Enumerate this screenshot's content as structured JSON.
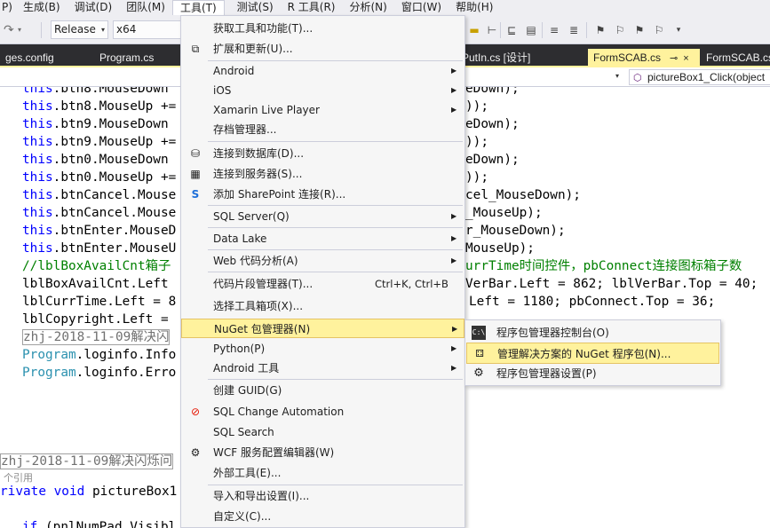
{
  "menubar": {
    "items": [
      {
        "label": "P)"
      },
      {
        "label": "生成(B)"
      },
      {
        "label": "调试(D)"
      },
      {
        "label": "团队(M)"
      },
      {
        "label": "工具(T)"
      },
      {
        "label": "测试(S)"
      },
      {
        "label": "R 工具(R)"
      },
      {
        "label": "分析(N)"
      },
      {
        "label": "窗口(W)"
      },
      {
        "label": "帮助(H)"
      }
    ]
  },
  "toolbar": {
    "configuration": "Release",
    "platform": "x64"
  },
  "tabs": [
    {
      "label": "ges.config"
    },
    {
      "label": "Program.cs"
    },
    {
      "label": "mPutIn.cs [设计]"
    },
    {
      "label": "FormSCAB.cs",
      "pin": "⊸",
      "close": "×"
    },
    {
      "label": "FormSCAB.cs"
    }
  ],
  "navbar": {
    "member": "pictureBox1_Click(object"
  },
  "code": {
    "lines": [
      {
        "kw": "this",
        "text": ".btn8.MouseDown",
        "right": "eDown);"
      },
      {
        "kw": "this",
        "text": ".btn8.MouseUp +=",
        "right": "));"
      },
      {
        "kw": "this",
        "text": ".btn9.MouseDown",
        "right": "eDown);"
      },
      {
        "kw": "this",
        "text": ".btn9.MouseUp +=",
        "right": "));"
      },
      {
        "kw": "this",
        "text": ".btn0.MouseDown",
        "right": "eDown);"
      },
      {
        "kw": "this",
        "text": ".btn0.MouseUp +=",
        "right": "));"
      },
      {
        "kw": "this",
        "text": ".btnCancel.Mouse",
        "right": "cel_MouseDown);"
      },
      {
        "kw": "this",
        "text": ".btnCancel.Mouse",
        "right": "_MouseUp);"
      },
      {
        "kw": "this",
        "text": ".btnEnter.MouseD",
        "right": "r_MouseDown);"
      },
      {
        "kw": "this",
        "text": ".btnEnter.MouseU",
        "right": "MouseUp);"
      },
      {
        "comment": "//lblBoxAvailCnt箱子",
        "right_comment": "urrTime时间控件，pbConnect连接图标箱子数"
      },
      {
        "text": "lblBoxAvailCnt.Left",
        "right": "VerBar.Left = 862; lblVerBar.Top = 40;"
      },
      {
        "text": "lblCurrTime.Left = 8",
        "right": "Left = 1180; pbConnect.Top = 36;"
      },
      {
        "text": "lblCopyright.Left =",
        "right": ""
      },
      {
        "boxed": "zhj-2018-11-09解决闪"
      },
      {
        "type": "Program",
        "text": ".loginfo.Info"
      },
      {
        "type": "Program",
        "text": ".loginfo.Erro"
      }
    ],
    "bottom_boxed": "zhj-2018-11-09解决闪烁问",
    "references": "个引用",
    "method_kw": "rivate void",
    "method_name": " pictureBox1",
    "if_kw": "if",
    "if_text": " (pnlNumPad.Visibl"
  },
  "menu": {
    "items": [
      {
        "icon": "none",
        "label": "获取工具和功能(T)..."
      },
      {
        "icon": "extensions-icon",
        "label": "扩展和更新(U)..."
      },
      {
        "label": "Android",
        "submenu": true
      },
      {
        "label": "iOS",
        "submenu": true
      },
      {
        "label": "Xamarin Live Player",
        "submenu": true
      },
      {
        "label": "存档管理器..."
      },
      {
        "icon": "connect-database-icon",
        "label": "连接到数据库(D)..."
      },
      {
        "icon": "connect-server-icon",
        "label": "连接到服务器(S)..."
      },
      {
        "icon": "sharepoint-icon",
        "label": "添加 SharePoint 连接(R)..."
      },
      {
        "label": "SQL Server(Q)",
        "submenu": true
      },
      {
        "label": "Data Lake",
        "submenu": true
      },
      {
        "label": "Web 代码分析(A)",
        "submenu": true
      },
      {
        "label": "代码片段管理器(T)...",
        "shortcut": "Ctrl+K, Ctrl+B"
      },
      {
        "label": "选择工具箱项(X)..."
      },
      {
        "label": "NuGet 包管理器(N)",
        "submenu": true,
        "highlighted": true
      },
      {
        "label": "Python(P)",
        "submenu": true
      },
      {
        "label": "Android 工具",
        "submenu": true
      },
      {
        "label": "创建 GUID(G)"
      },
      {
        "icon": "sql-change-automation-icon",
        "label": "SQL Change Automation"
      },
      {
        "label": "SQL Search"
      },
      {
        "icon": "wcf-config-icon",
        "label": "WCF 服务配置编辑器(W)"
      },
      {
        "label": "外部工具(E)..."
      },
      {
        "label": "导入和导出设置(I)..."
      },
      {
        "label": "自定义(C)..."
      }
    ]
  },
  "submenu": {
    "items": [
      {
        "icon": "console-icon",
        "label": "程序包管理器控制台(O)"
      },
      {
        "icon": "nuget-package-icon",
        "label": "管理解决方案的 NuGet 程序包(N)...",
        "highlighted": true
      },
      {
        "icon": "gear-icon",
        "label": "程序包管理器设置(P)"
      }
    ]
  },
  "colors": {
    "chrome": "#eeeef2",
    "tabstrip": "#2d2d30",
    "highlight": "#fff29d",
    "keyword": "#0000ff",
    "comment": "#008000",
    "type": "#2b91af"
  }
}
